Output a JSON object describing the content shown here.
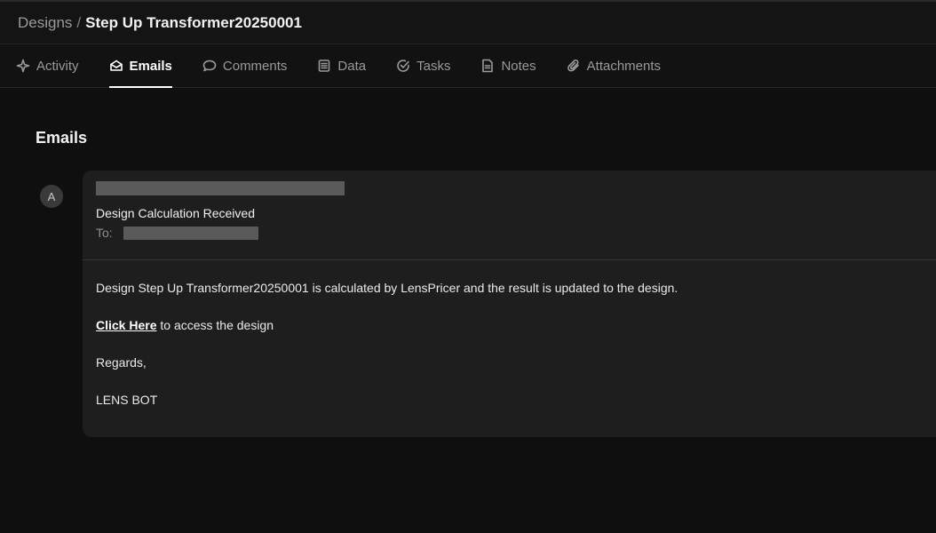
{
  "breadcrumb": {
    "parent": "Designs",
    "separator": "/",
    "current": "Step Up Transformer20250001"
  },
  "tabs": [
    {
      "label": "Activity",
      "icon": "activity-icon",
      "active": false
    },
    {
      "label": "Emails",
      "icon": "mail-icon",
      "active": true
    },
    {
      "label": "Comments",
      "icon": "comment-icon",
      "active": false
    },
    {
      "label": "Data",
      "icon": "data-icon",
      "active": false
    },
    {
      "label": "Tasks",
      "icon": "tasks-icon",
      "active": false
    },
    {
      "label": "Notes",
      "icon": "notes-icon",
      "active": false
    },
    {
      "label": "Attachments",
      "icon": "paperclip-icon",
      "active": false
    }
  ],
  "main": {
    "title": "Emails"
  },
  "email": {
    "avatar_initial": "A",
    "subject": "Design Calculation Received",
    "to_label": "To:",
    "body": {
      "line1": "Design Step Up Transformer20250001 is calculated by LensPricer and the result is updated to the design.",
      "link_text": "Click Here",
      "link_suffix": " to access the design",
      "regards": "Regards,",
      "signature": "LENS BOT"
    }
  },
  "colors": {
    "background": "#0f0f0f",
    "card": "#1e1e1e",
    "text": "#e6e6e6",
    "muted": "#9a9a9a",
    "redaction": "#5a5a5a"
  }
}
